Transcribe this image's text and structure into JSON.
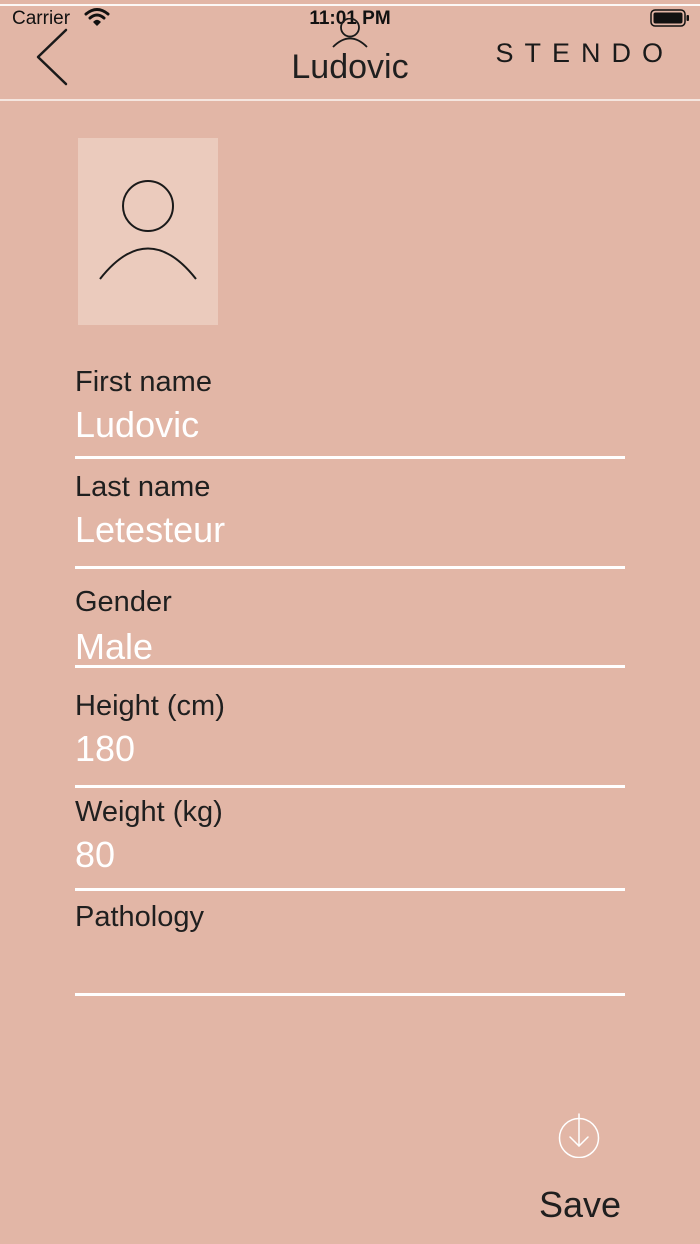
{
  "status_bar": {
    "carrier": "Carrier",
    "time": "11:01 PM",
    "wifi_icon": "wifi-icon",
    "battery_icon": "battery-icon"
  },
  "nav": {
    "back_icon": "chevron-left-icon",
    "profile_icon": "person-icon",
    "title": "Ludovic",
    "brand": "STENDO"
  },
  "avatar": {
    "icon": "person-icon"
  },
  "form": {
    "first_name": {
      "label": "First name",
      "value": "Ludovic"
    },
    "last_name": {
      "label": "Last name",
      "value": "Letesteur"
    },
    "gender": {
      "label": "Gender",
      "value": "Male"
    },
    "height": {
      "label": "Height (cm)",
      "value": "180"
    },
    "weight": {
      "label": "Weight (kg)",
      "value": "80"
    },
    "pathology": {
      "label": "Pathology",
      "value": ""
    }
  },
  "save": {
    "label": "Save",
    "icon": "download-icon"
  },
  "colors": {
    "background": "#e2b6a6",
    "avatar_background": "#ebcbbd",
    "value_text": "#ffffff",
    "label_text": "#1f1f1f"
  }
}
